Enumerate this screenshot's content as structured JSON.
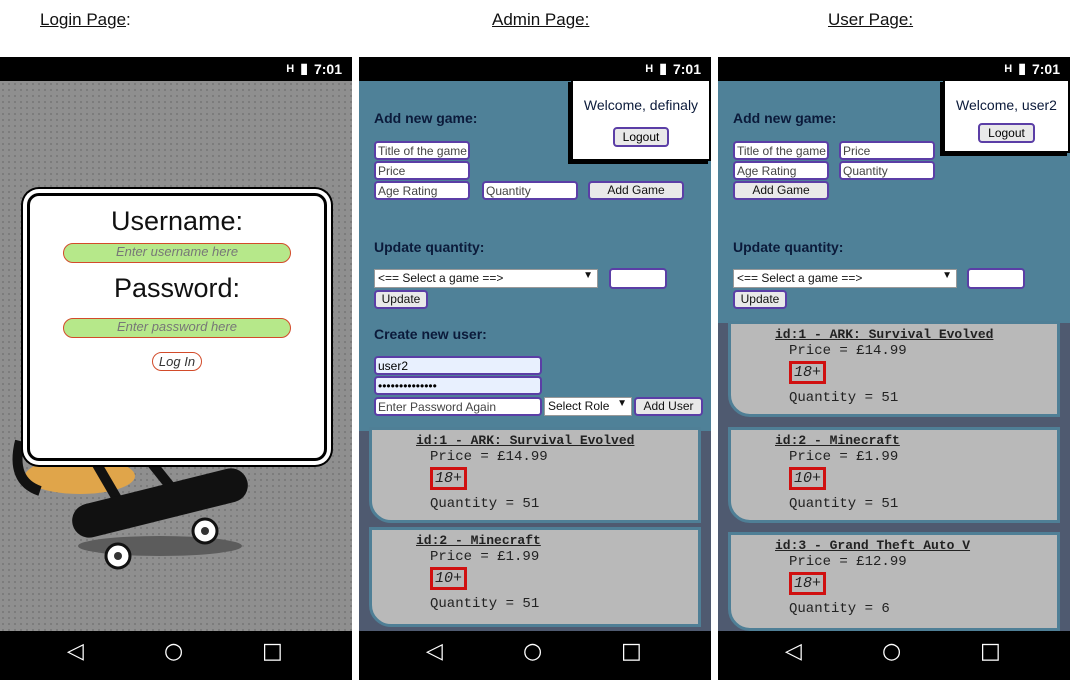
{
  "captions": {
    "login": "Login Page",
    "admin": "Admin Page",
    "user": "User Page",
    "colon": ":"
  },
  "status": {
    "signal": "H",
    "time": "7:01"
  },
  "nav": {
    "back": "◁",
    "home": "○",
    "recent": "□"
  },
  "login": {
    "username_label": "Username:",
    "username_placeholder": "Enter username here",
    "password_label": "Password:",
    "password_placeholder": "Enter password here",
    "button": "Log In"
  },
  "admin": {
    "welcome": "Welcome, definaly",
    "logout": "Logout",
    "add_game_title": "Add new game:",
    "title_placeholder": "Title of the game",
    "price_placeholder": "Price",
    "age_placeholder": "Age Rating",
    "quantity_placeholder": "Quantity",
    "add_game_button": "Add Game",
    "update_title": "Update quantity:",
    "select_game": "<== Select a game ==>",
    "update_button": "Update",
    "create_user_title": "Create new user:",
    "new_username": "user2",
    "new_password": "••••••••••••••",
    "password_again_placeholder": "Enter Password Again",
    "select_role": "Select Role",
    "add_user_button": "Add User",
    "games": [
      {
        "title": "id:1 - ARK: Survival Evolved",
        "price": "Price = £14.99",
        "age": "18+",
        "qty": "Quantity = 51"
      },
      {
        "title": "id:2 - Minecraft",
        "price": "Price = £1.99",
        "age": "10+",
        "qty": "Quantity = 51"
      }
    ]
  },
  "user": {
    "welcome": "Welcome, user2",
    "logout": "Logout",
    "add_game_title": "Add new game:",
    "title_placeholder": "Title of the game",
    "price_placeholder": "Price",
    "age_placeholder": "Age Rating",
    "quantity_placeholder": "Quantity",
    "add_game_button": "Add Game",
    "update_title": "Update quantity:",
    "select_game": "<== Select a game ==>",
    "update_button": "Update",
    "games": [
      {
        "title": "id:1 - ARK: Survival Evolved",
        "price": "Price = £14.99",
        "age": "18+",
        "qty": "Quantity = 51"
      },
      {
        "title": "id:2 - Minecraft",
        "price": "Price = £1.99",
        "age": "10+",
        "qty": "Quantity = 51"
      },
      {
        "title": "id:3 - Grand Theft Auto V",
        "price": "Price = £12.99",
        "age": "18+",
        "qty": "Quantity = 6"
      }
    ]
  }
}
